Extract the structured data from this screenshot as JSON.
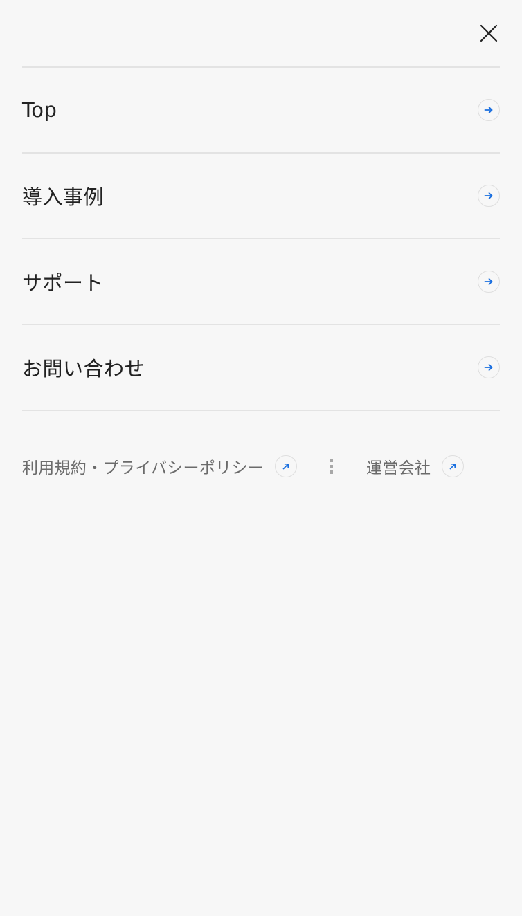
{
  "header": {
    "close_icon": "close-icon"
  },
  "menu": {
    "items": [
      {
        "label": "Top",
        "icon": "arrow-right-icon"
      },
      {
        "label": "導入事例",
        "icon": "arrow-right-icon"
      },
      {
        "label": "サポート",
        "icon": "arrow-right-icon"
      },
      {
        "label": "お問い合わせ",
        "icon": "arrow-right-icon"
      }
    ]
  },
  "footer": {
    "links": [
      {
        "label": "利用規約・プライバシーポリシー",
        "icon": "external-link-icon"
      },
      {
        "label": "運営会社",
        "icon": "external-link-icon"
      }
    ],
    "separator_icon": "vertical-dots-separator"
  },
  "colors": {
    "background": "#f7f7f7",
    "text": "#222222",
    "muted_text": "#6b6b6b",
    "divider": "#e3e3e3",
    "accent": "#1a6fe0"
  }
}
